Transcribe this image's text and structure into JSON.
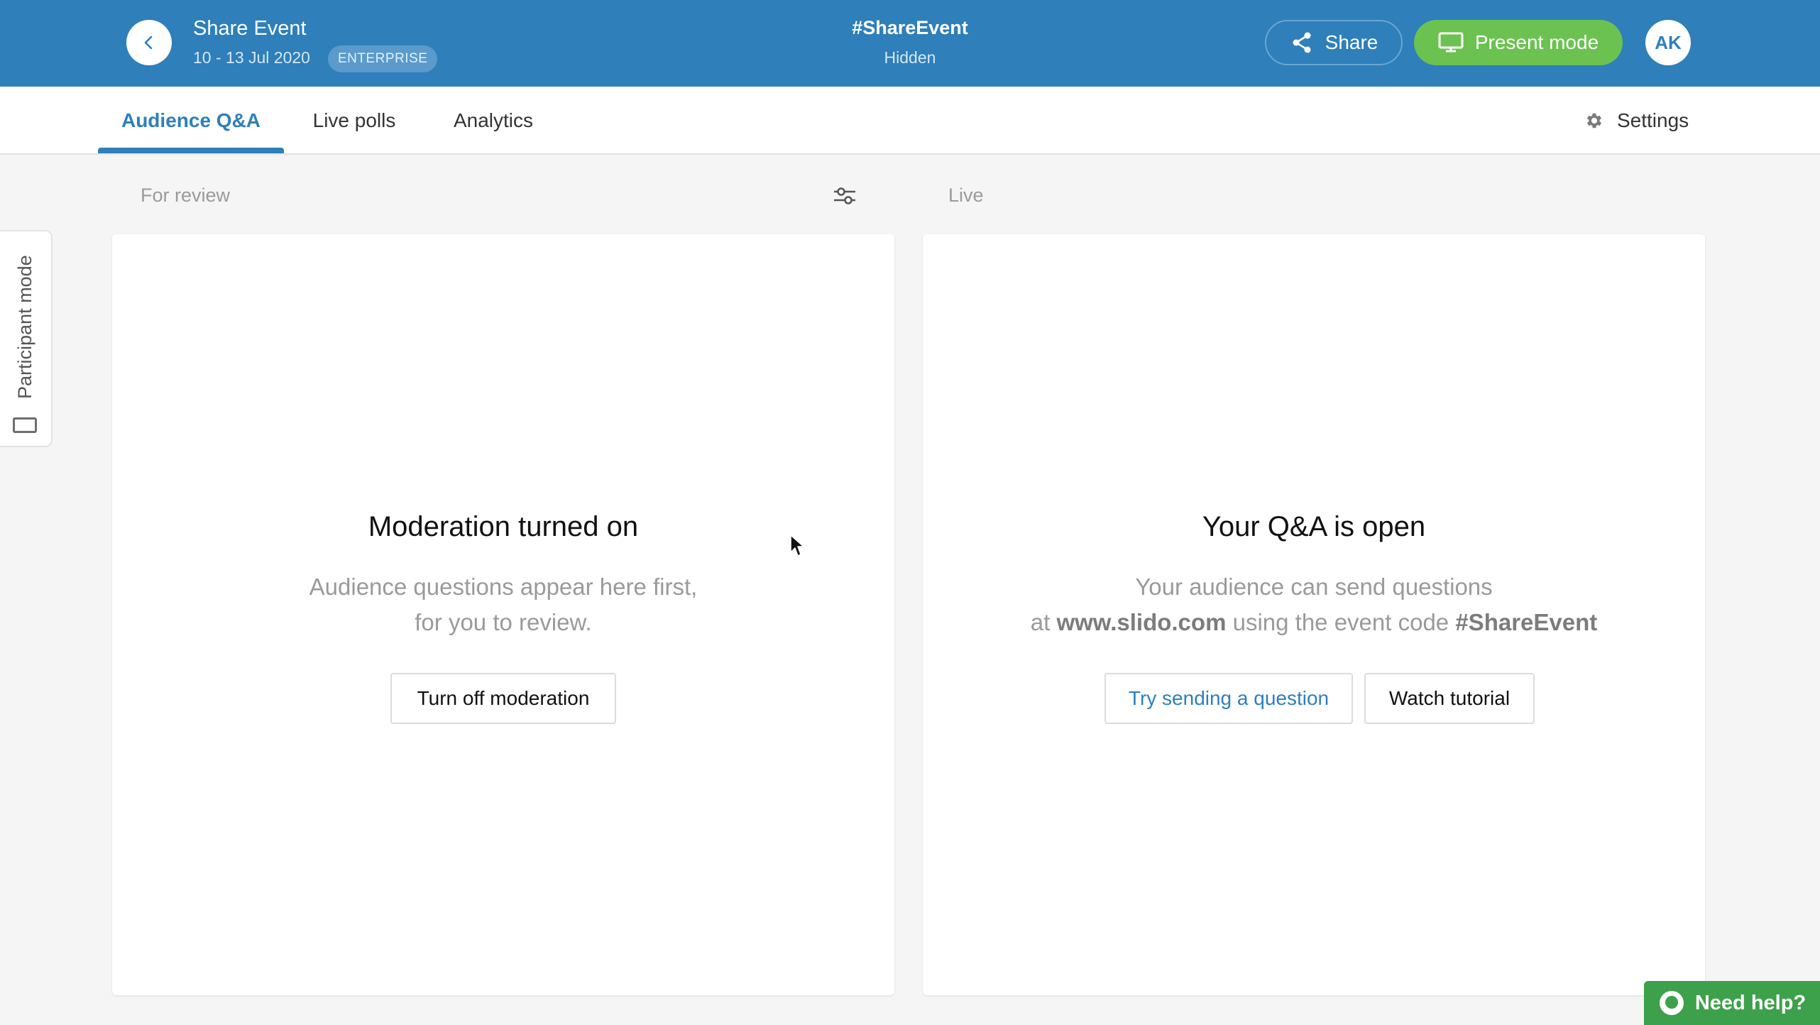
{
  "header": {
    "title": "Share Event",
    "dates": "10 - 13 Jul 2020",
    "plan_badge": "ENTERPRISE",
    "event_code": "#ShareEvent",
    "visibility": "Hidden",
    "share_label": "Share",
    "present_label": "Present mode",
    "avatar_initials": "AK",
    "icons": [
      "back-chevron-icon",
      "share-icon",
      "monitor-icon"
    ]
  },
  "tabs": {
    "items": [
      {
        "label": "Audience Q&A",
        "active": true
      },
      {
        "label": "Live polls",
        "active": false
      },
      {
        "label": "Analytics",
        "active": false
      }
    ],
    "settings_label": "Settings"
  },
  "review_column": {
    "label": "For review",
    "title": "Moderation turned on",
    "desc_line1": "Audience questions appear here first,",
    "desc_line2": "for you to review.",
    "button_label": "Turn off moderation"
  },
  "live_column": {
    "label": "Live",
    "title": "Your Q&A is open",
    "desc_line1": "Your audience can send questions",
    "desc_at": "at",
    "desc_site": "www.slido.com",
    "desc_middle": "using the event code",
    "desc_code": "#ShareEvent",
    "try_button_label": "Try sending a question",
    "tutorial_button_label": "Watch tutorial"
  },
  "side_tab": {
    "label": "Participant mode"
  },
  "help": {
    "label": "Need help?"
  },
  "colors": {
    "header_bg": "#2e7fba",
    "present_green": "#6bc250",
    "help_green": "#3da04a",
    "page_bg": "#f5f5f5"
  }
}
